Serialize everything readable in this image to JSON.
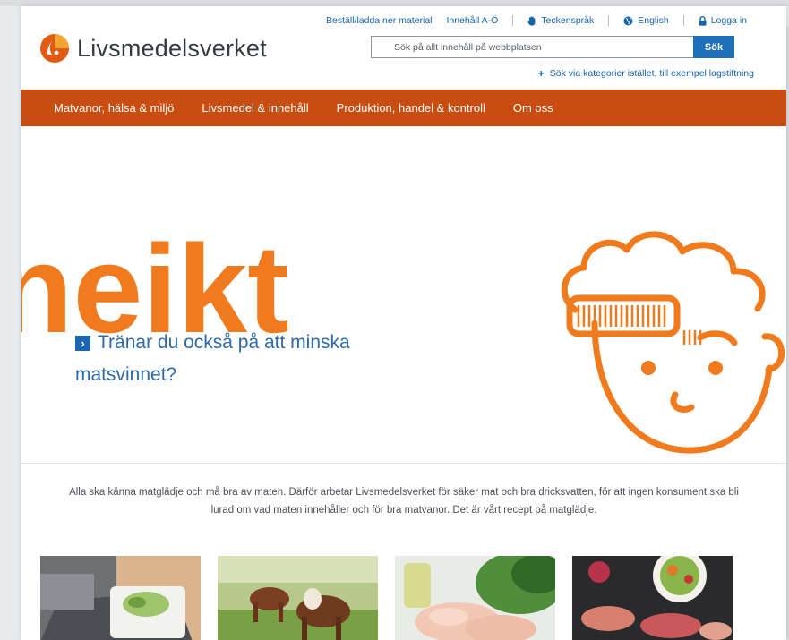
{
  "utility": {
    "order": "Beställ/ladda ner material",
    "index": "Innehåll A-Ö",
    "sign": "Teckenspråk",
    "english": "English",
    "login": "Logga in"
  },
  "logo": {
    "text": "Livsmedelsverket"
  },
  "search": {
    "placeholder": "Sök på allt innehåll på webbplatsen",
    "button": "Sök",
    "category_link": "Sök via kategorier istället, till exempel lagstiftning"
  },
  "nav": {
    "items": [
      "Matvanor, hälsa & miljö",
      "Livsmedel & innehåll",
      "Produktion, handel & kontroll",
      "Om oss"
    ]
  },
  "hero": {
    "caption": "Tränar du också på att minska matsvinnet?",
    "art_text": "neikt"
  },
  "intro": "Alla ska känna matglädje och må bra av maten. Därför arbetar Livsmedelsverket för säker mat och bra dricksvatten, för att ingen konsument ska bli lurad om vad maten innehåller och för bra matvanor. Det är vårt recept på matglädje.",
  "colors": {
    "brand_orange": "#c94d10",
    "link_blue": "#1463a8",
    "button_blue": "#1d6fb8",
    "art_orange": "#f07b1f"
  }
}
